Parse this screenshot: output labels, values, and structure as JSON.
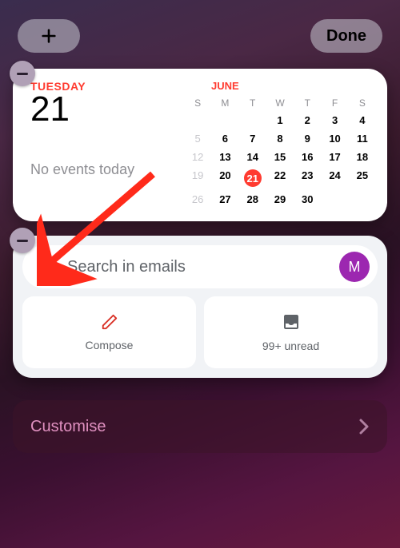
{
  "topbar": {
    "done_label": "Done"
  },
  "calendar": {
    "day_name": "TUESDAY",
    "day_num": "21",
    "events_text": "No events today",
    "month": "JUNE",
    "weekdays": [
      "S",
      "M",
      "T",
      "W",
      "T",
      "F",
      "S"
    ],
    "weeks": [
      [
        {
          "n": "",
          "dim": true
        },
        {
          "n": "",
          "dim": true
        },
        {
          "n": "",
          "dim": true
        },
        {
          "n": "1"
        },
        {
          "n": "2"
        },
        {
          "n": "3"
        },
        {
          "n": "4"
        }
      ],
      [
        {
          "n": "5",
          "dim": true
        },
        {
          "n": "6"
        },
        {
          "n": "7"
        },
        {
          "n": "8"
        },
        {
          "n": "9"
        },
        {
          "n": "10"
        },
        {
          "n": "11"
        }
      ],
      [
        {
          "n": "12",
          "dim": true
        },
        {
          "n": "13"
        },
        {
          "n": "14"
        },
        {
          "n": "15"
        },
        {
          "n": "16"
        },
        {
          "n": "17"
        },
        {
          "n": "18"
        }
      ],
      [
        {
          "n": "19",
          "dim": true
        },
        {
          "n": "20"
        },
        {
          "n": "21",
          "today": true
        },
        {
          "n": "22"
        },
        {
          "n": "23"
        },
        {
          "n": "24"
        },
        {
          "n": "25"
        }
      ],
      [
        {
          "n": "26",
          "dim": true
        },
        {
          "n": "27"
        },
        {
          "n": "28"
        },
        {
          "n": "29"
        },
        {
          "n": "30"
        },
        {
          "n": "",
          "dim": true
        },
        {
          "n": "",
          "dim": true
        }
      ]
    ]
  },
  "gmail": {
    "search_placeholder": "Search in emails",
    "avatar_initial": "M",
    "compose_label": "Compose",
    "unread_label": "99+ unread"
  },
  "customise": {
    "label": "Customise"
  }
}
